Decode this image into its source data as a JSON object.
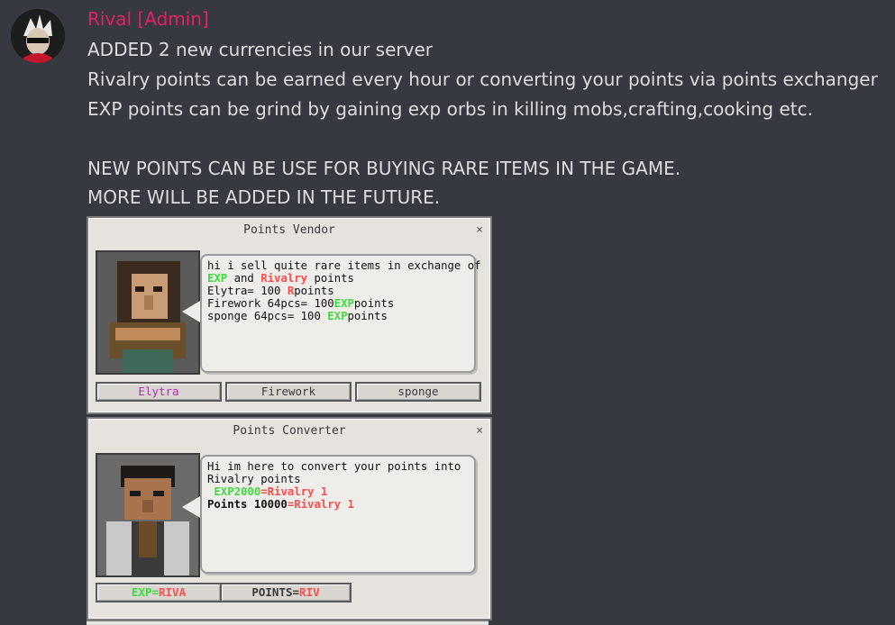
{
  "message": {
    "author": "Rival [Admin]",
    "lines": [
      "ADDED 2 new currencies in our server",
      "Rivalry points can be earned every hour or converting your points via points exchanger",
      "EXP points can be grind by gaining exp orbs in killing mobs,crafting,cooking etc.",
      "",
      "NEW POINTS CAN BE USE FOR BUYING RARE ITEMS IN THE GAME.",
      "MORE WILL BE ADDED IN THE FUTURE."
    ]
  },
  "vendor": {
    "title": "Points Vendor",
    "close": "×",
    "dialog": {
      "line1": "hi i sell quite rare items in exchange of",
      "exp": "EXP",
      "and": " and ",
      "rivalry": "Rivalry",
      "points": " points",
      "elytra_prefix": "Elytra= 100 ",
      "r": "R",
      "points_word": "points",
      "firework_prefix": "Firework 64pcs= 100",
      "sponge_prefix": "sponge 64pcs= 100 "
    },
    "buttons": [
      "Elytra",
      "Firework",
      "sponge"
    ]
  },
  "converter": {
    "title": "Points Converter",
    "close": "×",
    "dialog": {
      "line1": "Hi im here to convert your points into",
      "line2": "Rivalry points",
      "exp_rate": "EXP2000",
      "eq_riv": "=Rivalry 1",
      "points_rate": "Points 10000",
      "eq_riv2": "=Rivalry 1"
    },
    "buttons": {
      "exp_label": "EXP",
      "exp_sep": "=",
      "exp_riv": "RIVA",
      "points_label": "POINTS",
      "points_sep": "=",
      "points_riv": "RIV"
    }
  },
  "colors": {
    "author": "#e91e63",
    "exp": "#3cdc3c",
    "rivalry": "#ff4d4d",
    "elytra_button": "#b030b0"
  }
}
